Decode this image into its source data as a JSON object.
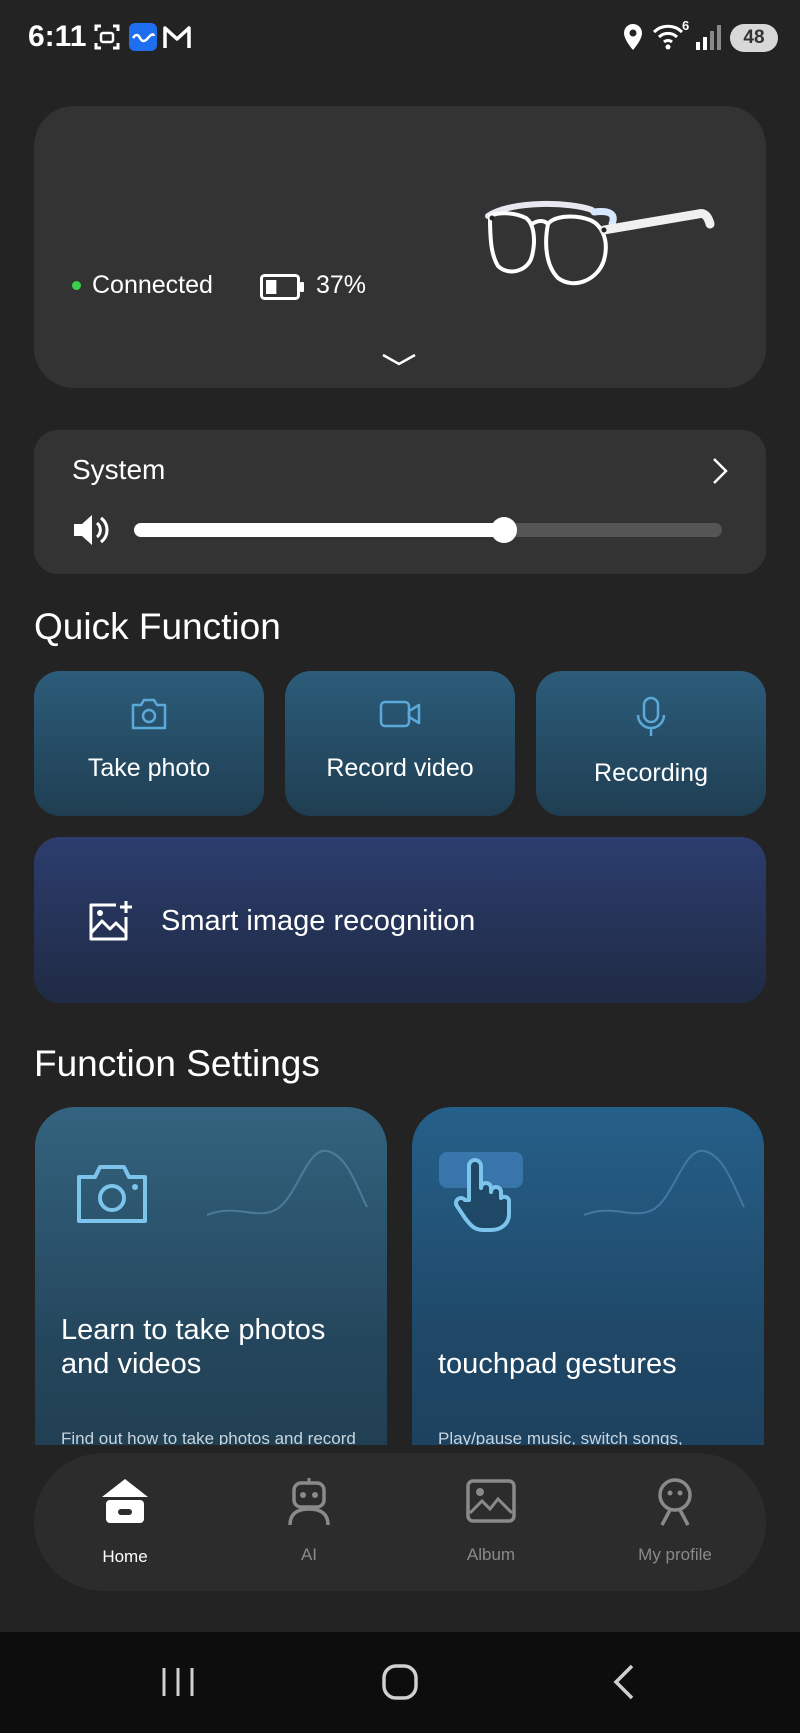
{
  "status_bar": {
    "time": "6:11",
    "battery": "48",
    "wifi_badge": "6"
  },
  "device": {
    "connection_status": "Connected",
    "battery_percent": "37%",
    "battery_level": 0.37,
    "status_color": "#3ad04a"
  },
  "system": {
    "title": "System",
    "volume_level": 0.63
  },
  "quick_function": {
    "title": "Quick Function",
    "items": [
      {
        "label": "Take photo",
        "icon": "camera-icon"
      },
      {
        "label": "Record video",
        "icon": "video-camera-icon"
      },
      {
        "label": "Recording",
        "icon": "microphone-icon"
      }
    ],
    "smart": {
      "label": "Smart image recognition",
      "icon": "image-add-icon"
    }
  },
  "function_settings": {
    "title": "Function Settings",
    "cards": [
      {
        "title": "Learn to take photos and videos",
        "desc": "Find out how to take photos and record",
        "icon": "camera-icon"
      },
      {
        "title": "touchpad gestures",
        "desc": "Play/pause music, switch songs,",
        "icon": "hand-pointer-icon"
      }
    ]
  },
  "bottom_nav": {
    "items": [
      {
        "label": "Home",
        "icon": "home-icon",
        "active": true
      },
      {
        "label": "AI",
        "icon": "robot-icon",
        "active": false
      },
      {
        "label": "Album",
        "icon": "image-icon",
        "active": false
      },
      {
        "label": "My profile",
        "icon": "profile-icon",
        "active": false
      }
    ]
  }
}
